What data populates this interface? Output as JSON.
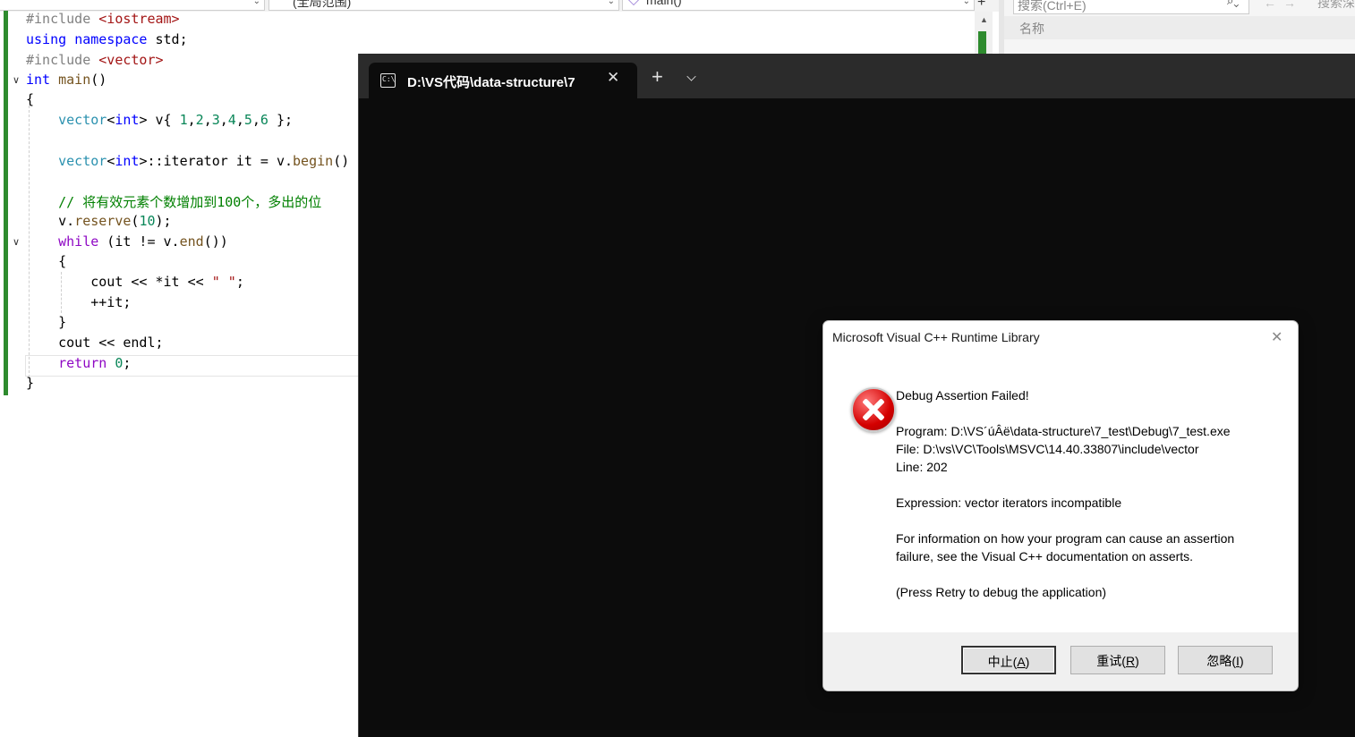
{
  "editor": {
    "nav": {
      "scope_combo": "(全局范围)",
      "member_combo": "main()"
    },
    "code": [
      {
        "tokens": [
          {
            "t": "#include ",
            "c": "pre"
          },
          {
            "t": "<iostream>",
            "c": "inc"
          }
        ]
      },
      {
        "tokens": [
          {
            "t": "using ",
            "c": "kw"
          },
          {
            "t": "namespace ",
            "c": "kw"
          },
          {
            "t": "std;",
            "c": ""
          }
        ]
      },
      {
        "tokens": [
          {
            "t": "#include ",
            "c": "pre"
          },
          {
            "t": "<vector>",
            "c": "inc"
          }
        ]
      },
      {
        "tokens": [
          {
            "t": "int ",
            "c": "kw"
          },
          {
            "t": "main",
            "c": "fn"
          },
          {
            "t": "()",
            "c": ""
          }
        ]
      },
      {
        "tokens": [
          {
            "t": "{",
            "c": ""
          }
        ]
      },
      {
        "tokens": [
          {
            "t": "    ",
            "c": ""
          },
          {
            "t": "vector",
            "c": "typ"
          },
          {
            "t": "<",
            "c": ""
          },
          {
            "t": "int",
            "c": "kw"
          },
          {
            "t": "> v{ ",
            "c": ""
          },
          {
            "t": "1",
            "c": "num"
          },
          {
            "t": ",",
            "c": ""
          },
          {
            "t": "2",
            "c": "num"
          },
          {
            "t": ",",
            "c": ""
          },
          {
            "t": "3",
            "c": "num"
          },
          {
            "t": ",",
            "c": ""
          },
          {
            "t": "4",
            "c": "num"
          },
          {
            "t": ",",
            "c": ""
          },
          {
            "t": "5",
            "c": "num"
          },
          {
            "t": ",",
            "c": ""
          },
          {
            "t": "6",
            "c": "num"
          },
          {
            "t": " };",
            "c": ""
          }
        ]
      },
      {
        "tokens": [
          {
            "t": "    ",
            "c": ""
          },
          {
            "t": "vector",
            "c": "typ"
          },
          {
            "t": "<",
            "c": ""
          },
          {
            "t": "int",
            "c": "kw"
          },
          {
            "t": ">::iterator it = v.",
            "c": ""
          },
          {
            "t": "begin",
            "c": "fn"
          },
          {
            "t": "()",
            "c": ""
          }
        ]
      },
      {
        "tokens": [
          {
            "t": "    ",
            "c": ""
          },
          {
            "t": "// 将有效元素个数增加到100个，多出的位",
            "c": "cmt"
          }
        ]
      },
      {
        "tokens": [
          {
            "t": "    v.",
            "c": ""
          },
          {
            "t": "reserve",
            "c": "fn"
          },
          {
            "t": "(",
            "c": ""
          },
          {
            "t": "10",
            "c": "num"
          },
          {
            "t": ");",
            "c": ""
          }
        ]
      },
      {
        "tokens": [
          {
            "t": "    ",
            "c": ""
          },
          {
            "t": "while",
            "c": "ctl"
          },
          {
            "t": " (it != v.",
            "c": ""
          },
          {
            "t": "end",
            "c": "fn"
          },
          {
            "t": "())",
            "c": ""
          }
        ]
      },
      {
        "tokens": [
          {
            "t": "    {",
            "c": ""
          }
        ]
      },
      {
        "tokens": [
          {
            "t": "        cout << *it << ",
            "c": ""
          },
          {
            "t": "\" \"",
            "c": "str"
          },
          {
            "t": ";",
            "c": ""
          }
        ]
      },
      {
        "tokens": [
          {
            "t": "        ++it;",
            "c": ""
          }
        ]
      },
      {
        "tokens": [
          {
            "t": "    }",
            "c": ""
          }
        ]
      },
      {
        "tokens": [
          {
            "t": "    cout << endl;",
            "c": ""
          }
        ]
      },
      {
        "tokens": [
          {
            "t": "    ",
            "c": ""
          },
          {
            "t": "return",
            "c": "ctl"
          },
          {
            "t": " ",
            "c": ""
          },
          {
            "t": "0",
            "c": "num"
          },
          {
            "t": ";",
            "c": ""
          }
        ]
      },
      {
        "tokens": [
          {
            "t": "}",
            "c": ""
          }
        ]
      }
    ]
  },
  "right_panel": {
    "search_placeholder": "搜索(Ctrl+E)",
    "search2_label": "搜索深",
    "header_label": "名称"
  },
  "terminal": {
    "tab_title": "D:\\VS代码\\data-structure\\7",
    "new_tab_icon": "plus-icon",
    "dropdown_icon": "chevron-down-icon"
  },
  "dialog": {
    "title": "Microsoft Visual C++ Runtime Library",
    "heading": "Debug Assertion Failed!",
    "program_line": "Program: D:\\VS´úÂë\\data-structure\\7_test\\Debug\\7_test.exe",
    "file_line": "File: D:\\vs\\VC\\Tools\\MSVC\\14.40.33807\\include\\vector",
    "line_line": "Line: 202",
    "expression_line": "Expression: vector iterators incompatible",
    "info_line1": "For information on how your program can cause an assertion",
    "info_line2": "failure, see the Visual C++ documentation on asserts.",
    "press_retry": "(Press Retry to debug the application)",
    "buttons": {
      "abort": {
        "text": "中止(",
        "key": "A",
        "end": ")"
      },
      "retry": {
        "text": "重试(",
        "key": "R",
        "end": ")"
      },
      "ignore": {
        "text": "忽略(",
        "key": "I",
        "end": ")"
      }
    },
    "icon": "error-icon"
  }
}
